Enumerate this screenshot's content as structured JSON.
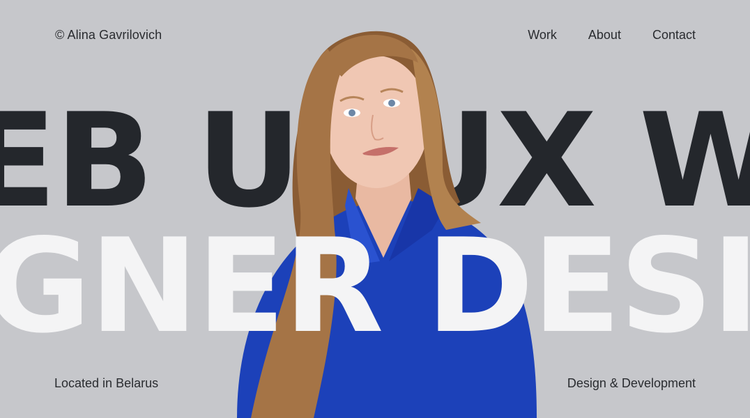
{
  "header": {
    "copyright": "© Alina Gavrilovich",
    "nav": [
      {
        "label": "Work"
      },
      {
        "label": "About"
      },
      {
        "label": "Contact"
      }
    ]
  },
  "hero": {
    "marquee_top": "EB UI/UX WEB",
    "marquee_bottom": "GNER DESIGNER"
  },
  "footer": {
    "location": "Located in Belarus",
    "tagline": "Design & Development"
  },
  "colors": {
    "background": "#c6c7cb",
    "dark_text": "#24272c",
    "light_text": "#f4f4f5",
    "shirt_blue": "#1c41b9",
    "hair": "#a57446"
  }
}
